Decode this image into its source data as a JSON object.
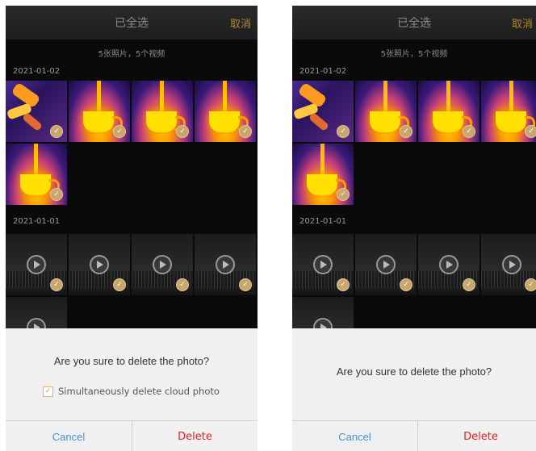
{
  "screens": [
    {
      "header": {
        "title": "已全选",
        "cancel": "取消"
      },
      "summary": "5张照片，5个视频",
      "groups": [
        {
          "date": "2021-01-02"
        },
        {
          "date": "2021-01-01"
        }
      ],
      "dialog": {
        "question": "Are you sure to delete the photo?",
        "cloud_checkbox_label": "Simultaneously delete cloud photo",
        "cloud_checkbox_checked": true,
        "cancel": "Cancel",
        "delete": "Delete"
      }
    },
    {
      "header": {
        "title": "已全选",
        "cancel": "取消"
      },
      "summary": "5张照片，5个视频",
      "groups": [
        {
          "date": "2021-01-02"
        },
        {
          "date": "2021-01-01"
        }
      ],
      "dialog": {
        "question": "Are you sure to delete the photo?",
        "cancel": "Cancel",
        "delete": "Delete"
      }
    }
  ],
  "icons": {
    "selected": "check-circle-icon",
    "play": "play-icon",
    "checkbox": "checkbox-checked-icon"
  },
  "colors": {
    "accent": "#c9a66b",
    "cancel_text": "#4a90c8",
    "delete_text": "#e02020"
  }
}
